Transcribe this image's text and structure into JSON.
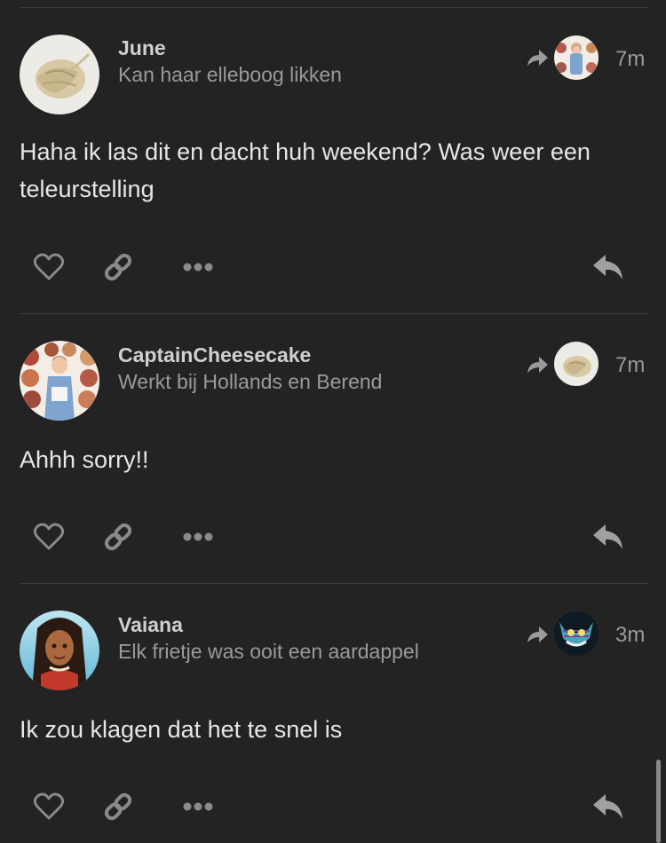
{
  "posts": [
    {
      "username": "June",
      "title": "Kan haar elleboog likken",
      "time": "7m",
      "text": "Haha ik las dit en dacht huh weekend? Was weer een teleurstelling"
    },
    {
      "username": "CaptainCheesecake",
      "title": "Werkt bij Hollands en Berend",
      "time": "7m",
      "text": "Ahhh sorry!!"
    },
    {
      "username": "Vaiana",
      "title": "Elk frietje was ooit een aardappel",
      "time": "3m",
      "text": "Ik zou klagen dat het te snel is"
    }
  ],
  "icons": {
    "like": "heart-icon",
    "link": "link-icon",
    "more": "more-icon",
    "reply": "reply-icon",
    "reply_to": "reply-arrow-icon"
  },
  "colors": {
    "background": "#232323",
    "text": "#e6e6e6",
    "muted": "#9a9a9a",
    "icon": "#8a8a8a"
  }
}
